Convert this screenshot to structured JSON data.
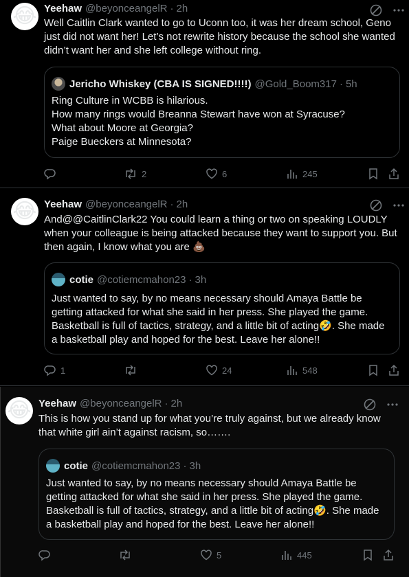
{
  "tweets": [
    {
      "author": {
        "name": "Yeehaw",
        "handle": "@beyonceangelR",
        "time": "2h",
        "avatar_emoji": "😂"
      },
      "text": "Well Caitlin Clark wanted to go to Uconn too, it was her dream school, Geno just did not want her! Let’s not rewrite history because the school she wanted didn’t want her and she left college without ring.",
      "quote": {
        "name": "Jericho Whiskey (CBA IS SIGNED!!!!)",
        "handle": "@Gold_Boom317",
        "time": "5h",
        "text": "Ring Culture in WCBB is hilarious.\nHow many rings would Breanna Stewart have won at Syracuse?\nWhat about Moore at Georgia?\nPaige Bueckers at Minnesota?"
      },
      "stats": {
        "replies": "",
        "reposts": "2",
        "likes": "6",
        "views": "245"
      }
    },
    {
      "author": {
        "name": "Yeehaw",
        "handle": "@beyonceangelR",
        "time": "2h",
        "avatar_emoji": "😂"
      },
      "text": "And@@CaitlinClark22 You could learn a thing or two on speaking LOUDLY when your colleague is being attacked because they want to support you. But then again, I know what you are 💩",
      "quote": {
        "name": "cotie",
        "handle": "@cotiemcmahon23",
        "time": "3h",
        "text": "Just wanted to say, by no means necessary should Amaya Battle be getting attacked for what she said in her press. She played the game. Basketball is full of tactics, strategy, and a little bit of acting🤣. She made a basketball play and hoped for the best. Leave her alone!!"
      },
      "stats": {
        "replies": "1",
        "reposts": "",
        "likes": "24",
        "views": "548"
      }
    },
    {
      "author": {
        "name": "Yeehaw",
        "handle": "@beyonceangelR",
        "time": "2h",
        "avatar_emoji": "😂"
      },
      "text": "This is how you stand up for what you’re truly against, but we already know that white girl ain’t against racism, so…….",
      "quote": {
        "name": "cotie",
        "handle": "@cotiemcmahon23",
        "time": "3h",
        "text": "Just wanted to say, by no means necessary should Amaya Battle be getting attacked for what she said in her press. She played the game. Basketball is full of tactics, strategy, and a little bit of acting🤣. She made a basketball play and hoped for the best. Leave her alone!!"
      },
      "stats": {
        "replies": "",
        "reposts": "",
        "likes": "5",
        "views": "445"
      }
    }
  ],
  "icons": {
    "reply": "reply-icon",
    "repost": "repost-icon",
    "like": "heart-icon",
    "views": "views-icon",
    "bookmark": "bookmark-icon",
    "share": "share-icon",
    "grok": "grok-icon",
    "more": "more-icon"
  },
  "colors": {
    "background": "#000000",
    "text": "#e7e9ea",
    "muted": "#71767b",
    "border": "#2f3336"
  }
}
